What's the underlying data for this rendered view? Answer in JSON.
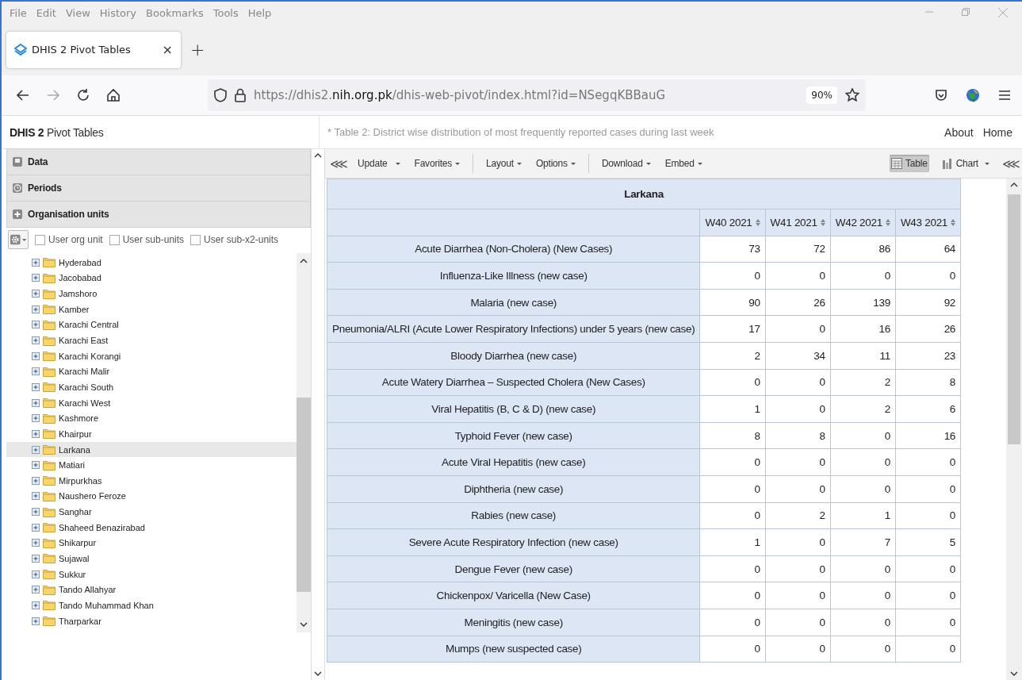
{
  "browser": {
    "menu": [
      "File",
      "Edit",
      "View",
      "History",
      "Bookmarks",
      "Tools",
      "Help"
    ],
    "tab": {
      "title": "DHIS 2 Pivot Tables",
      "close": "×"
    },
    "new_tab": "+",
    "url": "https://dhis2.**nih.org.pk**/dhis-web-pivot/index.html?id=NSegqKBBauG",
    "zoom": "90%"
  },
  "app": {
    "title": "**DHIS 2** Pivot Tables",
    "subtitle": "* Table 2: District wise distribution of most frequently reported cases during last week",
    "links": [
      "About",
      "Home"
    ]
  },
  "sidebar": {
    "sections": [
      {
        "label": "Data",
        "kind": "data"
      },
      {
        "label": "Periods",
        "kind": "periods"
      },
      {
        "label": "Organisation units",
        "kind": "orgunits"
      }
    ],
    "options": [
      {
        "label": "User org unit",
        "checked": false
      },
      {
        "label": "User sub-units",
        "checked": false
      },
      {
        "label": "User sub-x2-units",
        "checked": false
      }
    ],
    "tree": [
      {
        "label": "Hyderabad",
        "selected": false
      },
      {
        "label": "Jacobabad",
        "selected": false
      },
      {
        "label": "Jamshoro",
        "selected": false
      },
      {
        "label": "Kamber",
        "selected": false
      },
      {
        "label": "Karachi Central",
        "selected": false
      },
      {
        "label": "Karachi East",
        "selected": false
      },
      {
        "label": "Karachi Korangi",
        "selected": false
      },
      {
        "label": "Karachi Malir",
        "selected": false
      },
      {
        "label": "Karachi South",
        "selected": false
      },
      {
        "label": "Karachi West",
        "selected": false
      },
      {
        "label": "Kashmore",
        "selected": false
      },
      {
        "label": "Khairpur",
        "selected": false
      },
      {
        "label": "Larkana",
        "selected": true
      },
      {
        "label": "Matiari",
        "selected": false
      },
      {
        "label": "Mirpurkhas",
        "selected": false
      },
      {
        "label": "Naushero Feroze",
        "selected": false
      },
      {
        "label": "Sanghar",
        "selected": false
      },
      {
        "label": "Shaheed Benazirabad",
        "selected": false
      },
      {
        "label": "Shikarpur",
        "selected": false
      },
      {
        "label": "Sujawal",
        "selected": false
      },
      {
        "label": "Sukkur",
        "selected": false
      },
      {
        "label": "Tando Allahyar",
        "selected": false
      },
      {
        "label": "Tando Muhammad Khan",
        "selected": false
      },
      {
        "label": "Tharparkar",
        "selected": false
      }
    ]
  },
  "toolbar": {
    "collapse": "⋘",
    "buttons": [
      {
        "label": "Update",
        "kind": "primary"
      },
      {
        "label": "Favorites",
        "kind": "menu"
      },
      {
        "label": "Layout",
        "kind": "menu"
      },
      {
        "label": "Options",
        "kind": "menu"
      },
      {
        "label": "Download",
        "kind": "menu"
      },
      {
        "label": "Embed",
        "kind": "menu"
      }
    ],
    "views": [
      {
        "label": "Table",
        "selected": true,
        "kind": "table"
      },
      {
        "label": "Chart",
        "selected": false,
        "kind": "chart"
      }
    ],
    "expand": "⋘"
  },
  "table": {
    "title": "Larkana",
    "columns": [
      "W40 2021",
      "W41 2021",
      "W42 2021",
      "W43 2021"
    ],
    "rows": [
      {
        "label": "Acute Diarrhea (Non-Cholera) (New Cases)",
        "values": [
          "73",
          "72",
          "86",
          "64"
        ]
      },
      {
        "label": "Influenza-Like Illness (new case)",
        "values": [
          "0",
          "0",
          "0",
          "0"
        ]
      },
      {
        "label": "Malaria (new case)",
        "values": [
          "90",
          "26",
          "139",
          "92"
        ]
      },
      {
        "label": "Pneumonia/ALRI (Acute Lower Respiratory Infections) under 5 years (new case)",
        "values": [
          "17",
          "0",
          "16",
          "26"
        ]
      },
      {
        "label": "Bloody Diarrhea (new case)",
        "values": [
          "2",
          "34",
          "11",
          "23"
        ]
      },
      {
        "label": "Acute Watery Diarrhea – Suspected Cholera (New Cases)",
        "values": [
          "0",
          "0",
          "2",
          "8"
        ]
      },
      {
        "label": "Viral Hepatitis (B, C & D) (new case)",
        "values": [
          "1",
          "0",
          "2",
          "6"
        ]
      },
      {
        "label": "Typhoid Fever (new case)",
        "values": [
          "8",
          "8",
          "0",
          "16"
        ]
      },
      {
        "label": "Acute Viral Hepatitis (new case)",
        "values": [
          "0",
          "0",
          "0",
          "0"
        ]
      },
      {
        "label": "Diphtheria (new case)",
        "values": [
          "0",
          "0",
          "0",
          "0"
        ]
      },
      {
        "label": "Rabies (new case)",
        "values": [
          "0",
          "2",
          "1",
          "0"
        ]
      },
      {
        "label": "Severe Acute Respiratory Infection (new case)",
        "values": [
          "1",
          "0",
          "7",
          "5"
        ]
      },
      {
        "label": "Dengue Fever (new case)",
        "values": [
          "0",
          "0",
          "0",
          "0"
        ]
      },
      {
        "label": "Chickenpox/ Varicella (New Case)",
        "values": [
          "0",
          "0",
          "0",
          "0"
        ]
      },
      {
        "label": "Meningitis (new case)",
        "values": [
          "0",
          "0",
          "0",
          "0"
        ]
      },
      {
        "label": "Mumps (new suspected case)",
        "values": [
          "0",
          "0",
          "0",
          "0"
        ]
      }
    ]
  }
}
